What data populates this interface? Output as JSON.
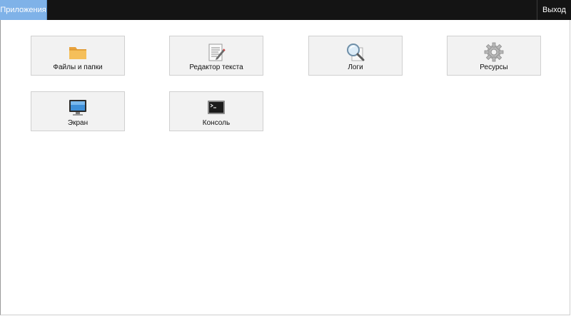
{
  "header": {
    "apps_tab": "Приложения",
    "logout": "Выход"
  },
  "apps": [
    {
      "label": "Файлы и папки",
      "icon": "folder-icon"
    },
    {
      "label": "Редактор текста",
      "icon": "text-editor-icon"
    },
    {
      "label": "Логи",
      "icon": "magnifier-icon"
    },
    {
      "label": "Ресурсы",
      "icon": "gear-icon"
    },
    {
      "label": "Экран",
      "icon": "monitor-icon"
    },
    {
      "label": "Консоль",
      "icon": "terminal-icon"
    }
  ],
  "colors": {
    "topbar": "#141414",
    "active_tab": "#7fb2e8",
    "tile_bg": "#f2f2f2"
  }
}
